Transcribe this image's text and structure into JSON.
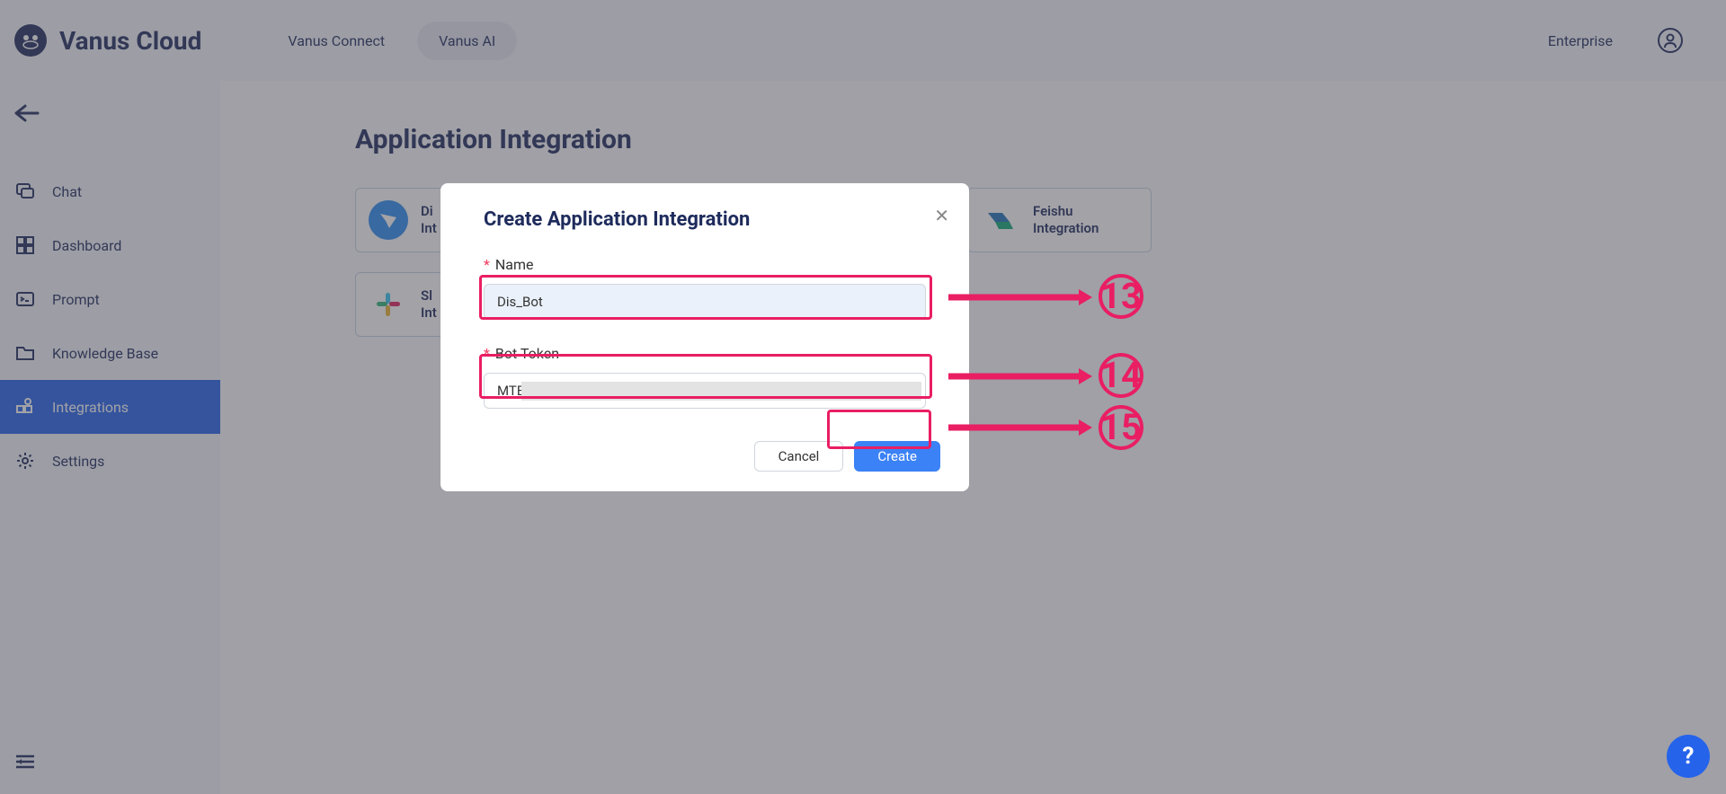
{
  "brand": "Vanus Cloud",
  "nav": {
    "tabs": [
      "Vanus Connect",
      "Vanus AI"
    ],
    "active_index": 1,
    "enterprise": "Enterprise"
  },
  "sidebar": {
    "items": [
      {
        "label": "Chat",
        "icon": "chat"
      },
      {
        "label": "Dashboard",
        "icon": "dashboard"
      },
      {
        "label": "Prompt",
        "icon": "prompt"
      },
      {
        "label": "Knowledge Base",
        "icon": "folder"
      },
      {
        "label": "Integrations",
        "icon": "integrations"
      },
      {
        "label": "Settings",
        "icon": "gear"
      }
    ],
    "active_index": 4
  },
  "page": {
    "title": "Application Integration",
    "integrations": [
      {
        "label_line1": "Di",
        "label_line2": "Int",
        "full_partial": "Di...",
        "icon": "dingtalk",
        "color": "#2A8CF0"
      },
      {
        "label_line1": "",
        "label_line2": "",
        "full_partial": "",
        "icon": "",
        "color": ""
      },
      {
        "label_line1": "",
        "label_line2": "",
        "full_partial": "",
        "icon": "",
        "color": ""
      },
      {
        "label_line1": "Feishu",
        "label_line2": "Integration",
        "full_partial": "Feishu Integration",
        "icon": "feishu",
        "color": "#1E73B6"
      },
      {
        "label_line1": "Sl",
        "label_line2": "Int",
        "full_partial": "Sl...",
        "icon": "slack",
        "color": ""
      }
    ]
  },
  "modal": {
    "title": "Create Application Integration",
    "fields": {
      "name": {
        "label": "Name",
        "value": "Dis_Bot"
      },
      "bot_token": {
        "label": "Bot Token",
        "value": "MTE"
      }
    },
    "buttons": {
      "cancel": "Cancel",
      "create": "Create"
    }
  },
  "annotations": {
    "callouts": [
      "13",
      "14",
      "15"
    ],
    "color": "#E91E63"
  },
  "help_fab": "?"
}
